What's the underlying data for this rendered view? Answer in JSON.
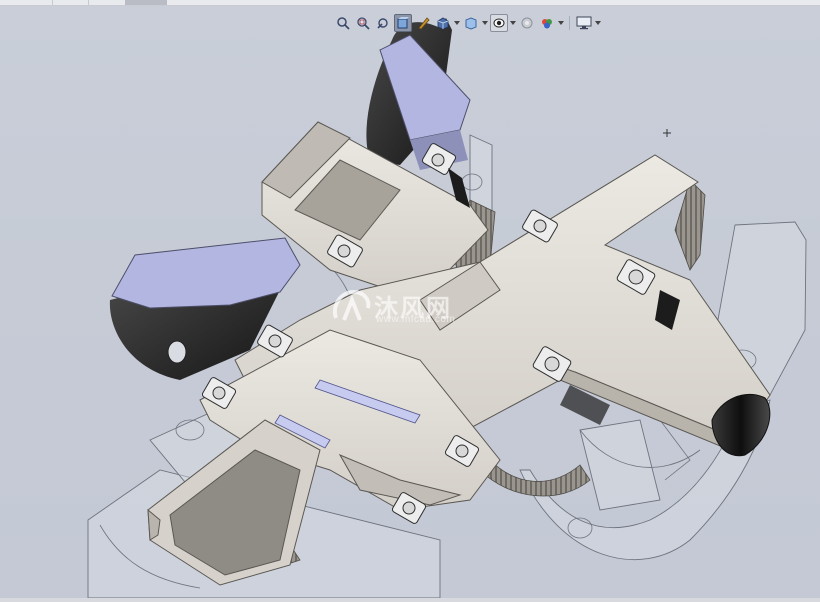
{
  "tabs": [
    "",
    "",
    ""
  ],
  "toolbar": {
    "items": [
      {
        "icon": "zoom-to-fit-icon"
      },
      {
        "icon": "zoom-to-area-icon"
      },
      {
        "icon": "previous-view-icon"
      },
      {
        "icon": "section-view-icon",
        "state": "active"
      },
      {
        "icon": "dynamic-annotation-icon"
      },
      {
        "icon": "view-orientation-icon"
      },
      {
        "icon": "display-style-icon"
      },
      {
        "icon": "hide-show-items-icon",
        "state": "pressed"
      },
      {
        "icon": "edit-appearance-icon"
      },
      {
        "icon": "apply-scene-icon"
      },
      {
        "icon": "view-settings-icon"
      }
    ]
  },
  "watermark": {
    "text": "沐风网",
    "url": "www.mfcad.com",
    "logo": "mfcad-logo"
  },
  "colors": {
    "viewport_bg": "#c8cdd8",
    "steel": "#e6e2db",
    "steel_shadow": "#908c86",
    "bracket_face": "#b3b6e0",
    "dark_metal": "#2b2b2b",
    "glass": "#dfe3ea"
  }
}
